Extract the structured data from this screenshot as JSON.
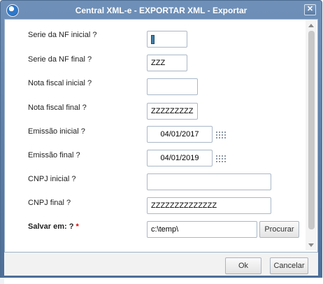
{
  "window": {
    "title": "Central XML-e - EXPORTAR XML - Exportar",
    "close_glyph": "✕"
  },
  "form": {
    "serie_inicial": {
      "label": "Serie da NF inicial ?",
      "value": ""
    },
    "serie_final": {
      "label": "Serie da NF final ?",
      "value": "ZZZ"
    },
    "nota_inicial": {
      "label": "Nota fiscal inicial ?",
      "value": ""
    },
    "nota_final": {
      "label": "Nota fiscal final ?",
      "value": "ZZZZZZZZZ"
    },
    "emissao_inicial": {
      "label": "Emissão inicial ?",
      "value": "04/01/2017"
    },
    "emissao_final": {
      "label": "Emissão final ?",
      "value": "04/01/2019"
    },
    "cnpj_inicial": {
      "label": "CNPJ inicial ?",
      "value": ""
    },
    "cnpj_final": {
      "label": "CNPJ final ?",
      "value": "ZZZZZZZZZZZZZZ"
    },
    "salvar_em": {
      "label": "Salvar em: ?",
      "required_mark": "*",
      "value": "c:\\temp\\",
      "browse_label": "Procurar"
    }
  },
  "footer": {
    "ok_label": "Ok",
    "cancel_label": "Cancelar"
  },
  "icons": {
    "app": "totvs-logo-icon",
    "calendar": "calendar-grid-icon",
    "close": "close-icon"
  },
  "colors": {
    "titlebar": "#5b7ca6",
    "required": "#e00000",
    "caret": "#3f7ea8"
  }
}
